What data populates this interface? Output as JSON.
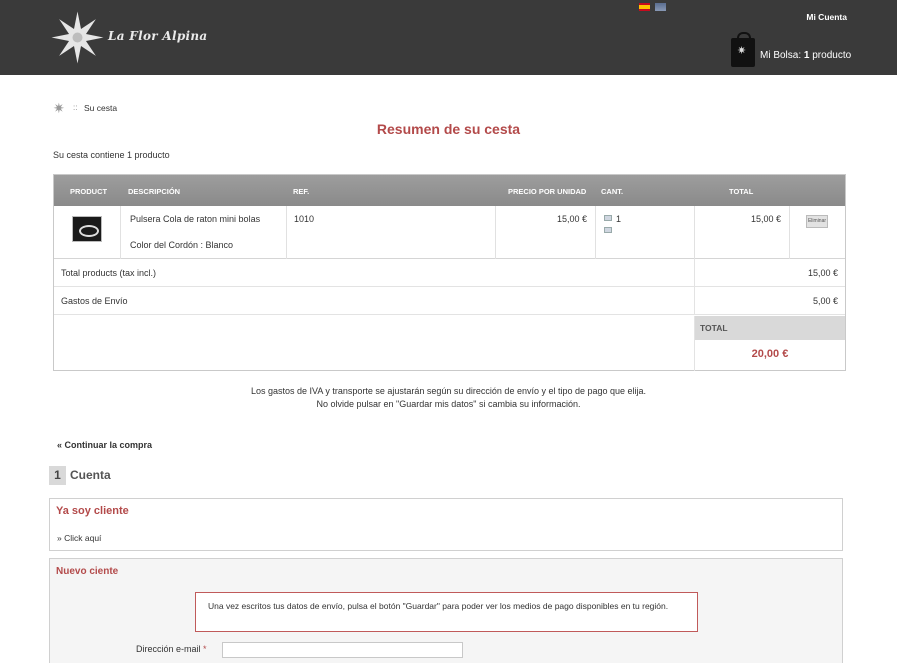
{
  "header": {
    "logo_text": "La Flor Alpina",
    "account_link": "Mi Cuenta",
    "bag_label": "Mi Bolsa:",
    "bag_count": "1",
    "bag_unit": "producto"
  },
  "breadcrumb": {
    "sep": "::",
    "current": "Su cesta"
  },
  "page_title": "Resumen de su cesta",
  "cart_count_text": "Su cesta contiene 1 producto",
  "table": {
    "headers": {
      "product": "PRODUCT",
      "description": "DESCRIPCIÓN",
      "ref": "REF.",
      "unit_price": "PRECIO POR UNIDAD",
      "qty": "CANT.",
      "total": "TOTAL"
    },
    "rows": [
      {
        "name": "Pulsera Cola de raton mini bolas",
        "attribute": "Color del Cordón : Blanco",
        "ref": "1010",
        "unit_price": "15,00 €",
        "qty": "1",
        "total": "15,00 €",
        "delete_label": "Eliminar"
      }
    ]
  },
  "summary": {
    "products_label": "Total products (tax incl.)",
    "products_value": "15,00 €",
    "shipping_label": "Gastos de Envío",
    "shipping_value": "5,00 €",
    "total_label": "TOTAL",
    "total_value": "20,00 €"
  },
  "notice": {
    "line1": "Los gastos de IVA y transporte se ajustarán según su dirección de envío y el tipo de pago que elija.",
    "line2": "No olvide pulsar en \"Guardar mis datos\" si cambia su información."
  },
  "continue_link": "« Continuar la compra",
  "step": {
    "number": "1",
    "title": "Cuenta"
  },
  "existing_client": {
    "title": "Ya soy cliente",
    "link": "» Click aquí"
  },
  "new_client": {
    "title": "Nuevo ciente",
    "warning": "Una vez escritos tus datos de envío, pulsa el botón \"Guardar\" para poder ver los medios de pago disponibles en tu región.",
    "email_label": "Dirección e-mail",
    "required_mark": "*",
    "email_value": ""
  }
}
